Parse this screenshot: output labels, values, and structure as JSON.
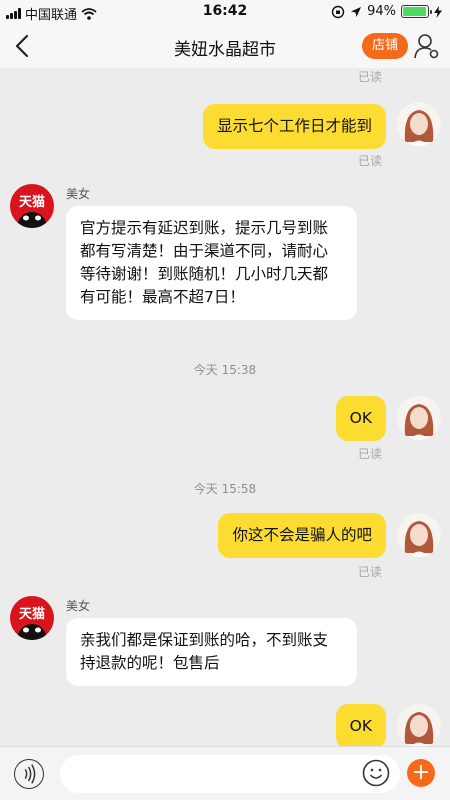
{
  "status_bar": {
    "carrier": "中国联通",
    "time": "16:42",
    "battery_percent": "94%",
    "battery_level": 0.94
  },
  "nav": {
    "title": "美妞水晶超市",
    "store_label": "店铺"
  },
  "chat": {
    "top_read": "已读",
    "messages": [
      {
        "side": "self",
        "text": "显示七个工作日才能到",
        "status": "已读"
      },
      {
        "side": "other",
        "sender": "美女",
        "avatar_label": "天猫",
        "text": "官方提示有延迟到账，提示几号到账都有写清楚！由于渠道不同，请耐心等待谢谢！到账随机！几小时几天都有可能！最高不超7日！"
      },
      {
        "side": "time",
        "text": "今天 15:38"
      },
      {
        "side": "self",
        "text": "OK",
        "status": "已读"
      },
      {
        "side": "time",
        "text": "今天 15:58"
      },
      {
        "side": "self",
        "text": "你这不会是骗人的吧",
        "status": "已读"
      },
      {
        "side": "other",
        "sender": "美女",
        "avatar_label": "天猫",
        "text": "亲我们都是保证到账的哈，不到账支持退款的呢！包售后"
      },
      {
        "side": "self",
        "text": "OK"
      }
    ]
  },
  "icons": {
    "back": "chevron-left-icon",
    "profile": "person-settings-icon",
    "voice": "voice-icon",
    "emoji": "smiley-icon",
    "plus": "plus-icon"
  },
  "colors": {
    "accent": "#f56a1a",
    "self_bubble": "#fddc31",
    "brand_avatar": "#d9141d"
  }
}
